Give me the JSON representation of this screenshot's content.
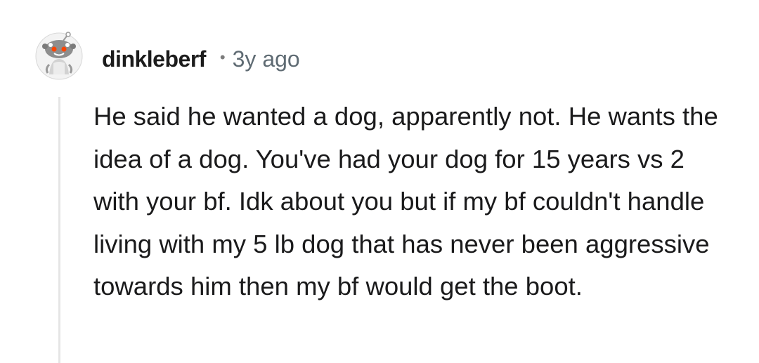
{
  "comment": {
    "author": "dinkleberf",
    "separator": "•",
    "age": "3y ago",
    "avatar_icon": "snoo-avatar-icon",
    "body": "He said he wanted a dog, apparently not. He wants the idea of a dog. You've had your dog for 15 years vs 2 with your bf. Idk about you but if my bf couldn't handle living with my 5 lb dog that has never been aggressive towards him then my bf would get the boot."
  },
  "colors": {
    "background": "#ffffff",
    "text": "#1a1a1b",
    "meta_text": "#5f6b73",
    "thread_line": "#e5e5e5"
  }
}
